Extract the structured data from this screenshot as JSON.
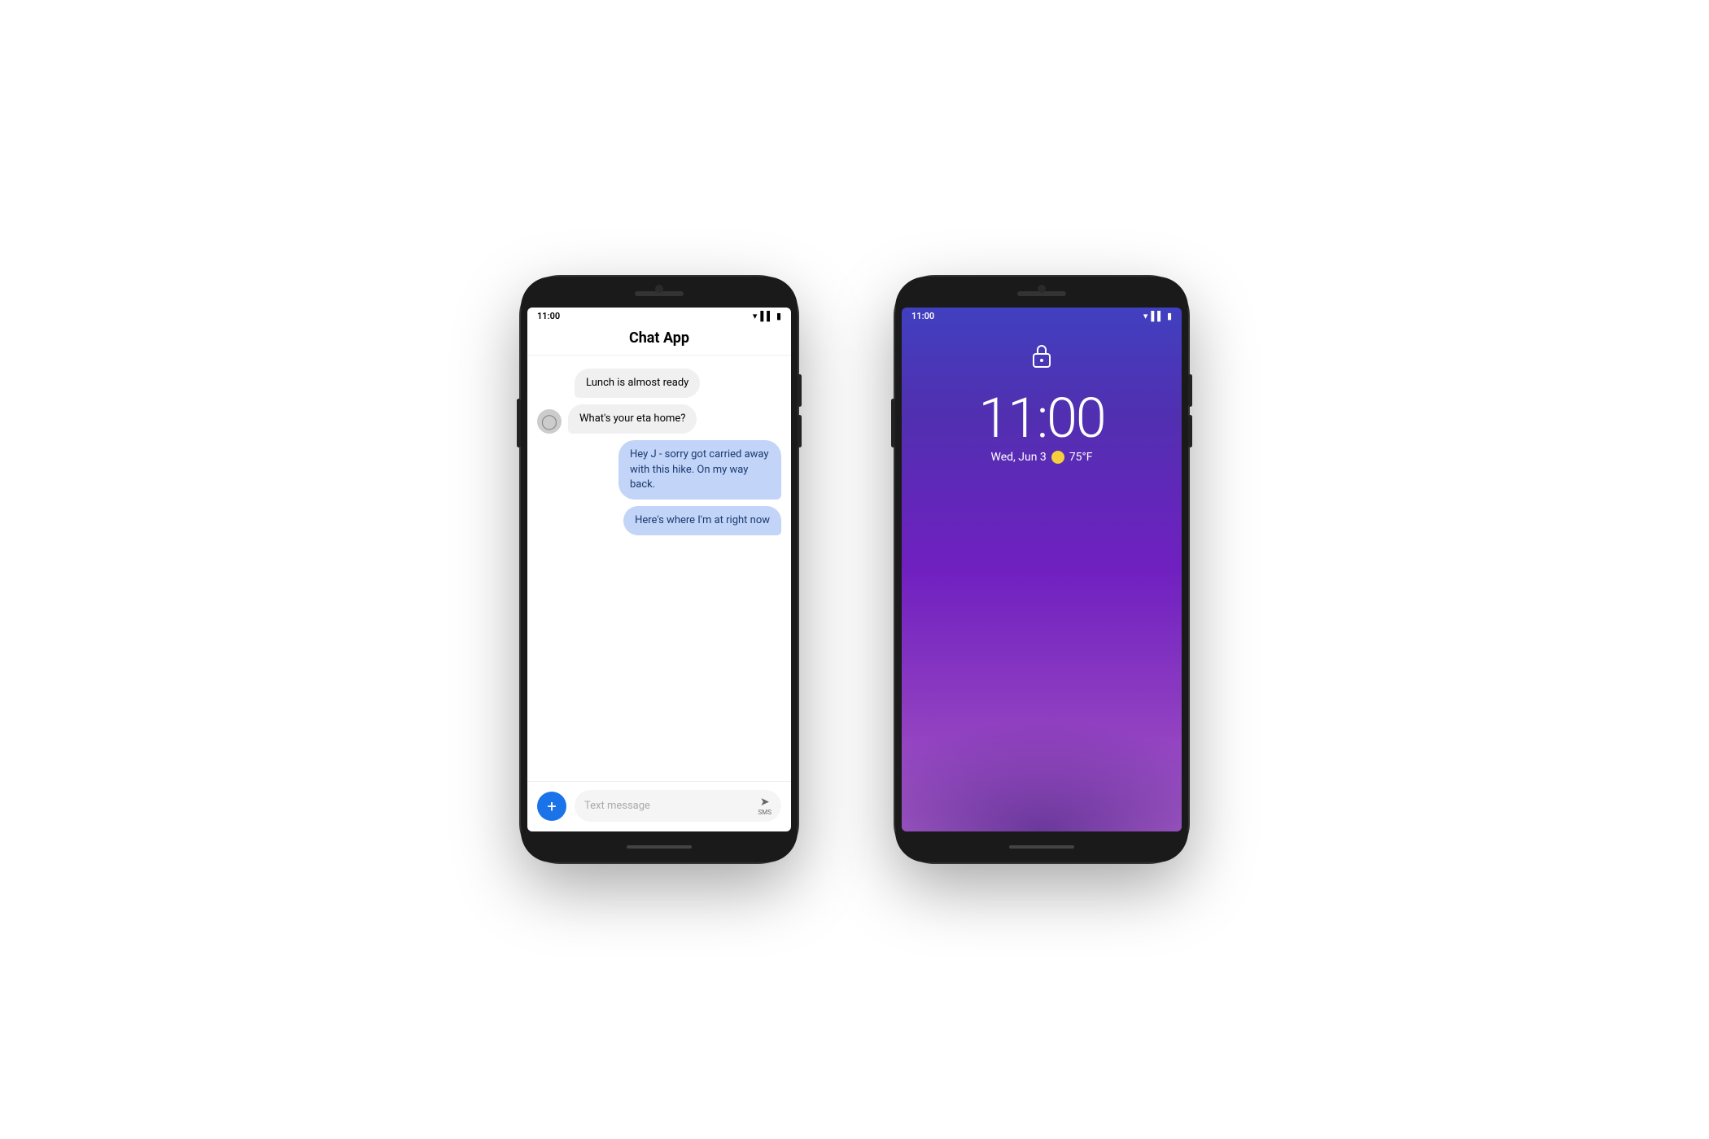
{
  "left_phone": {
    "status_bar": {
      "time": "11:00"
    },
    "header": {
      "title": "Chat App"
    },
    "messages": [
      {
        "id": "msg1",
        "type": "received",
        "has_avatar": false,
        "text": "Lunch is almost ready",
        "show_avatar": false
      },
      {
        "id": "msg2",
        "type": "received",
        "has_avatar": true,
        "text": "What's your eta home?",
        "show_avatar": true
      },
      {
        "id": "msg3",
        "type": "sent",
        "text": "Hey J - sorry got carried away with this hike. On my way back.",
        "show_avatar": false
      },
      {
        "id": "msg4",
        "type": "sent",
        "text": "Here's where I'm at right now",
        "show_avatar": false
      }
    ],
    "input": {
      "placeholder": "Text message",
      "sms_label": "SMS"
    }
  },
  "right_phone": {
    "status_bar": {
      "time": "11:00"
    },
    "time": "11:00",
    "date": "Wed, Jun 3",
    "weather_emoji": "☀",
    "temperature": "75°F"
  }
}
